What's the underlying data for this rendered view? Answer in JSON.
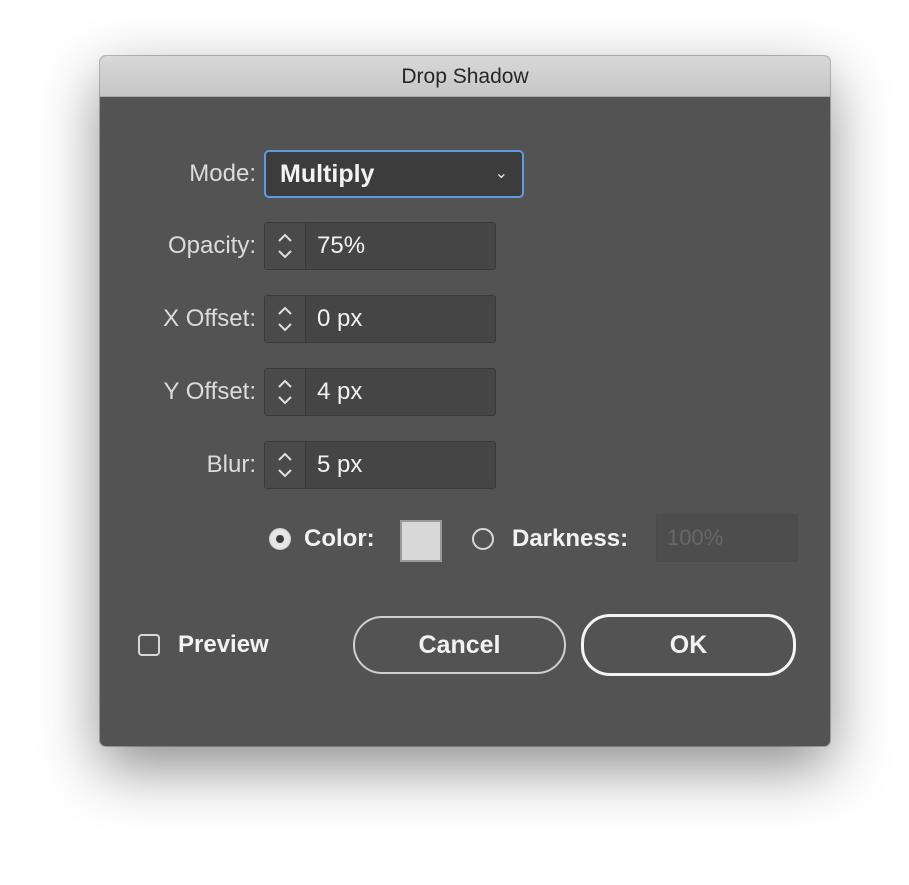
{
  "dialog": {
    "title": "Drop Shadow"
  },
  "mode": {
    "label": "Mode:",
    "value": "Multiply",
    "chevron": "⌄"
  },
  "opacity": {
    "label": "Opacity:",
    "value": "75%"
  },
  "x_offset": {
    "label": "X Offset:",
    "value": "0 px"
  },
  "y_offset": {
    "label": "Y Offset:",
    "value": "4 px"
  },
  "blur": {
    "label": "Blur:",
    "value": "5 px"
  },
  "color_option": {
    "label": "Color:",
    "selected": true,
    "swatch": "#d8d8d8"
  },
  "darkness_option": {
    "label": "Darkness:",
    "selected": false,
    "value": "100%"
  },
  "preview": {
    "label": "Preview",
    "checked": false
  },
  "buttons": {
    "cancel": "Cancel",
    "ok": "OK"
  },
  "colors": {
    "dialog_bg": "#535353",
    "focus_ring": "#5f9be0"
  },
  "icons": {
    "stepper": "stepper-arrows-icon",
    "dropdown": "chevron-down-icon"
  }
}
